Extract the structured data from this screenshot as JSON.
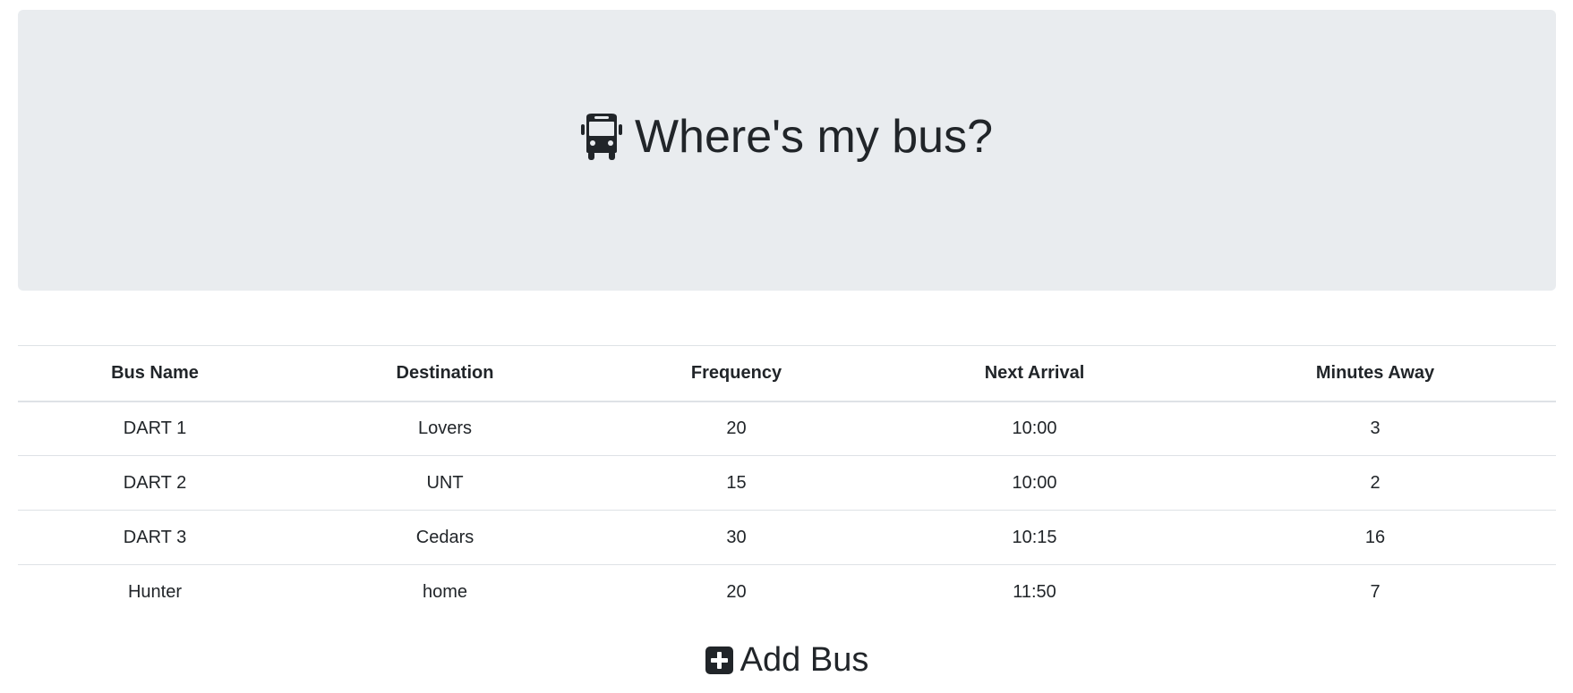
{
  "header": {
    "title": "Where's my bus?",
    "icon": "bus-icon"
  },
  "table": {
    "columns": [
      "Bus Name",
      "Destination",
      "Frequency",
      "Next Arrival",
      "Minutes Away"
    ],
    "rows": [
      [
        "DART 1",
        "Lovers",
        "20",
        "10:00",
        "3"
      ],
      [
        "DART 2",
        "UNT",
        "15",
        "10:00",
        "2"
      ],
      [
        "DART 3",
        "Cedars",
        "30",
        "10:15",
        "16"
      ],
      [
        "Hunter",
        "home",
        "20",
        "11:50",
        "7"
      ]
    ]
  },
  "add_bus": {
    "label": "Add Bus",
    "icon": "plus-square-icon"
  },
  "colors": {
    "jumbotron_bg": "#e9ecef",
    "text": "#212529",
    "border": "#dee2e6"
  }
}
